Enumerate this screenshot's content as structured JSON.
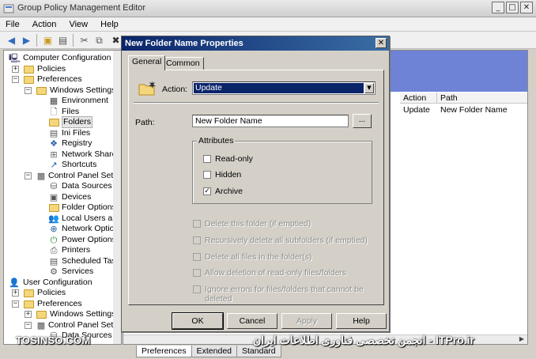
{
  "window": {
    "title": "Group Policy Management Editor"
  },
  "menu": [
    "File",
    "Action",
    "View",
    "Help"
  ],
  "tree": {
    "items": [
      {
        "label": "Computer Configuration",
        "icon": "computer-icon"
      },
      {
        "label": "Policies",
        "icon": "folder-icon"
      },
      {
        "label": "Preferences",
        "icon": "folder-icon"
      },
      {
        "label": "Windows Settings",
        "icon": "folder-icon"
      },
      {
        "label": "Environment",
        "icon": "environment-icon"
      },
      {
        "label": "Files",
        "icon": "file-icon"
      },
      {
        "label": "Folders",
        "icon": "folder-icon"
      },
      {
        "label": "Ini Files",
        "icon": "ini-icon"
      },
      {
        "label": "Registry",
        "icon": "registry-icon"
      },
      {
        "label": "Network Shares",
        "icon": "network-share-icon"
      },
      {
        "label": "Shortcuts",
        "icon": "shortcut-icon"
      },
      {
        "label": "Control Panel Settings",
        "icon": "control-panel-icon"
      },
      {
        "label": "Data Sources",
        "icon": "data-source-icon"
      },
      {
        "label": "Devices",
        "icon": "device-icon"
      },
      {
        "label": "Folder Options",
        "icon": "folder-options-icon"
      },
      {
        "label": "Local Users and Gr",
        "icon": "users-icon"
      },
      {
        "label": "Network Options",
        "icon": "network-icon"
      },
      {
        "label": "Power Options",
        "icon": "power-icon"
      },
      {
        "label": "Printers",
        "icon": "printer-icon"
      },
      {
        "label": "Scheduled Tasks",
        "icon": "task-icon"
      },
      {
        "label": "Services",
        "icon": "services-icon"
      },
      {
        "label": "User Configuration",
        "icon": "user-icon"
      },
      {
        "label": "Policies",
        "icon": "folder-icon"
      },
      {
        "label": "Preferences",
        "icon": "folder-icon"
      },
      {
        "label": "Windows Settings",
        "icon": "folder-icon"
      },
      {
        "label": "Control Panel Settings",
        "icon": "control-panel-icon"
      },
      {
        "label": "Data Sources",
        "icon": "data-source-icon"
      }
    ]
  },
  "list": {
    "columns": [
      "Action",
      "Path"
    ],
    "rows": [
      {
        "action": "Update",
        "path": "New Folder Name"
      }
    ]
  },
  "bottom_tabs": [
    "Preferences",
    "Extended",
    "Standard"
  ],
  "watermark": {
    "left": "TOSINSO.COM",
    "right": "انجمن تخصصی فناوری اطلاعات ایران - ITPro.ir"
  },
  "dialog": {
    "title": "New Folder Name Properties",
    "tabs": [
      "General",
      "Common"
    ],
    "action_label": "Action:",
    "action_value": "Update",
    "path_label": "Path:",
    "path_value": "New Folder Name",
    "browse_label": "...",
    "attributes_label": "Attributes",
    "attributes": [
      {
        "label": "Read-only",
        "checked": false
      },
      {
        "label": "Hidden",
        "checked": false
      },
      {
        "label": "Archive",
        "checked": true
      }
    ],
    "options": [
      "Delete this folder (if emptied)",
      "Recursively delete all subfolders (if emptied)",
      "Delete all files in the folder(s)",
      "Allow deletion of read-only files/folders",
      "Ignore errors for files/folders that cannot be deleted"
    ],
    "buttons": {
      "ok": "OK",
      "cancel": "Cancel",
      "apply": "Apply",
      "help": "Help"
    }
  }
}
